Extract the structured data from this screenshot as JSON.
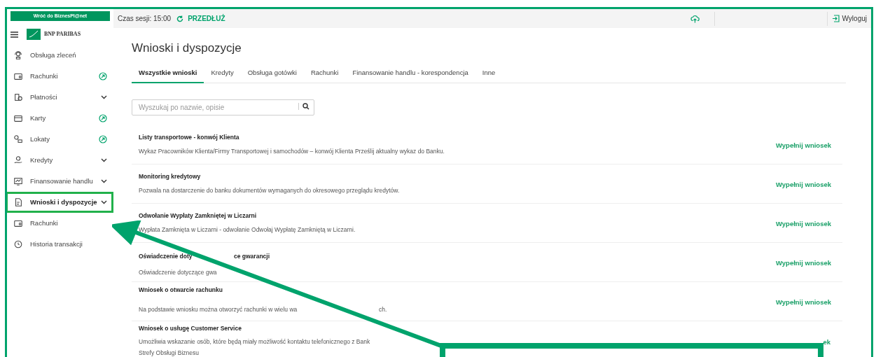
{
  "sidebar": {
    "back_button": "Wróć do BiznesPl@net",
    "logo_text": "BNP PARIBAS",
    "items": [
      {
        "label": "Obsługa zleceń",
        "kind": "plain",
        "selected": false
      },
      {
        "label": "Rachunki",
        "kind": "external",
        "selected": false
      },
      {
        "label": "Płatności",
        "kind": "group",
        "selected": false
      },
      {
        "label": "Karty",
        "kind": "external",
        "selected": false
      },
      {
        "label": "Lokaty",
        "kind": "external",
        "selected": false
      },
      {
        "label": "Kredyty",
        "kind": "group",
        "selected": false
      },
      {
        "label": "Finansowanie handlu",
        "kind": "group",
        "selected": false
      },
      {
        "label": "Wnioski i dyspozycje",
        "kind": "group",
        "selected": true
      },
      {
        "label": "Rachunki",
        "kind": "plain",
        "selected": false
      },
      {
        "label": "Historia transakcji",
        "kind": "plain",
        "selected": false
      }
    ]
  },
  "top_bar": {
    "session_label": "Czas sesji: 15:00",
    "extend_button": "PRZEDŁUŻ",
    "logout_button": "Wyloguj"
  },
  "page_title": "Wnioski i dyspozycje",
  "tabs": [
    {
      "label": "Wszystkie wnioski",
      "selected": true
    },
    {
      "label": "Kredyty",
      "selected": false
    },
    {
      "label": "Obsługa gotówki",
      "selected": false
    },
    {
      "label": "Rachunki",
      "selected": false
    },
    {
      "label": "Finansowanie handlu - korespondencja",
      "selected": false
    },
    {
      "label": "Inne",
      "selected": false
    }
  ],
  "search": {
    "placeholder": "Wyszukaj po nazwie, opisie"
  },
  "requests": [
    {
      "title": [
        "Listy transportowe - konwój Klienta"
      ],
      "description": [
        [
          "Wykaz Pracowników Klienta/Firmy Transportowej i samochodów – konwój Klienta Prześlij aktualny wykaz do Banku."
        ]
      ],
      "action": "Wypełnij wniosek"
    },
    {
      "title": [
        "Monitoring kredytowy"
      ],
      "description": [
        [
          "Pozwala na dostarczenie do banku dokumentów wymaganych do okresowego przeglądu kredytów."
        ]
      ],
      "action": "Wypełnij wniosek"
    },
    {
      "title": [
        "Odwołanie Wypłaty Zamkniętej w Liczarni"
      ],
      "description": [
        [
          "Wypłata Zamknięta w Liczarni - odwołanie Odwołaj Wypłatę Zamkniętą w Liczarni."
        ]
      ],
      "action": "Wypełnij wniosek"
    },
    {
      "title": [
        "Oświadczenie doty",
        "ce gwarancji"
      ],
      "description": [
        [
          "Oświadczenie dotyczące gwa"
        ]
      ],
      "action": "Wypełnij wniosek"
    },
    {
      "title": [
        "Wniosek o otwarcie rachunku"
      ],
      "description": [
        [
          "Na podstawie wniosku można otworzyć rachunki w wielu wa",
          "ch."
        ]
      ],
      "action": "Wypełnij wniosek"
    },
    {
      "title": [
        "Wniosek o usługę Customer Service"
      ],
      "description": [
        [
          "Umożliwia wskazanie osób, które będą miały możliwość kontaktu telefonicznego z Bank"
        ],
        [
          "Strefy Obsługi Biznesu"
        ]
      ],
      "action": "ek"
    }
  ]
}
